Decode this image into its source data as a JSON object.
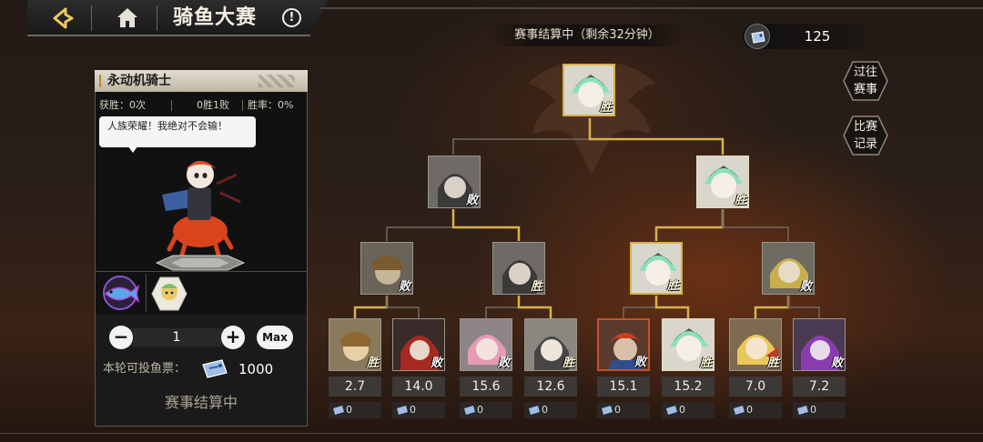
{
  "header": {
    "title": "骑鱼大赛",
    "info_icon": "!"
  },
  "status": {
    "text": "赛事结算中（剩余32分钟）"
  },
  "currency": {
    "icon": "fish-ticket-icon",
    "value": "125"
  },
  "side_buttons": [
    {
      "label": "过往\n赛事"
    },
    {
      "label": "比赛\n记录"
    }
  ],
  "panel": {
    "name": "永动机骑士",
    "stats": {
      "wins": "获胜：0次",
      "record": "0胜1败",
      "rate": "胜率：0%"
    },
    "quote": "人族荣耀！我绝对不会输！",
    "bet": {
      "minus": "−",
      "qty": "1",
      "plus": "+",
      "max": "Max",
      "ticket_label": "本轮可投鱼票：",
      "ticket_count": "1000",
      "settle": "赛事结算中"
    }
  },
  "bracket": {
    "final": {
      "result": "胜"
    },
    "semis": [
      {
        "result": "败"
      },
      {
        "result": "胜"
      }
    ],
    "quarters": [
      {
        "result": "败"
      },
      {
        "result": "胜"
      },
      {
        "result": "胜"
      },
      {
        "result": "败"
      }
    ],
    "round1": [
      {
        "result": "胜",
        "odds": "2.7",
        "bets": "0"
      },
      {
        "result": "败",
        "odds": "14.0",
        "bets": "0"
      },
      {
        "result": "败",
        "odds": "15.6",
        "bets": "0"
      },
      {
        "result": "胜",
        "odds": "12.6",
        "bets": "0"
      },
      {
        "result": "败",
        "odds": "15.1",
        "bets": "0"
      },
      {
        "result": "胜",
        "odds": "15.2",
        "bets": "0"
      },
      {
        "result": "胜",
        "odds": "7.0",
        "bets": "0"
      },
      {
        "result": "败",
        "odds": "7.2",
        "bets": "0"
      }
    ]
  },
  "colors": {
    "gold": "#d8b24a",
    "panel_bg": "#111111",
    "line_grey": "#6e6a62"
  }
}
